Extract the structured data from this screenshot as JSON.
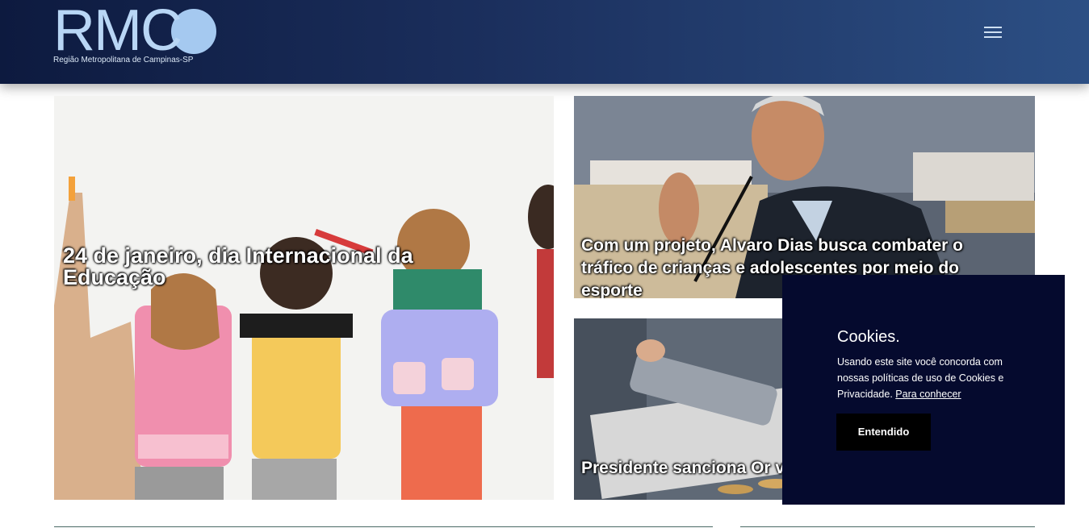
{
  "header": {
    "logo_text": "RMC",
    "logo_subtitle": "Região Metropolitana de Campinas-SP",
    "menu_icon": "hamburger-menu-icon"
  },
  "articles": [
    {
      "title": "24 de janeiro, dia Internacional da Educação"
    },
    {
      "title": "Com um projeto, Alvaro Dias busca combater o tráfico de crianças e adolescentes por meio do esporte"
    },
    {
      "title": "Presidente sanciona Or vetos"
    }
  ],
  "cookie": {
    "title": "Cookies.",
    "text": "Usando este site você concorda com nossas políticas de uso de Cookies e Privacidade.",
    "link": "Para conhecer",
    "button": "Entendido"
  },
  "colors": {
    "header_start": "#0d1a3f",
    "header_end": "#2c4f84",
    "logo": "#b8d6f5",
    "cookie_bg": "#050a2e",
    "button_bg": "#000000"
  }
}
